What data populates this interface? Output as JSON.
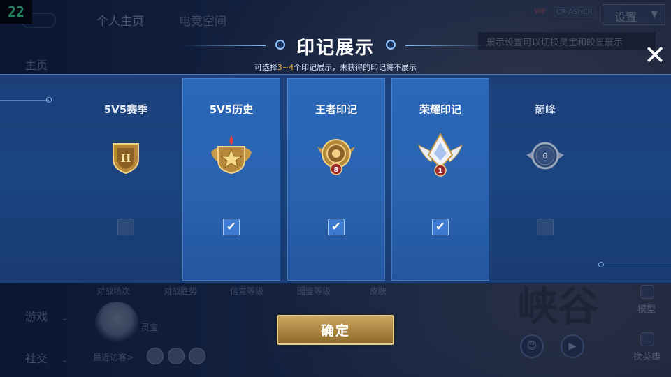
{
  "status": {
    "fps": "22"
  },
  "background": {
    "top_tabs": [
      "个人主页",
      "电竞空间"
    ],
    "vip_badge": "VIP",
    "vip_text": "CR·ASHCR",
    "settings_label": "设置",
    "settings_tip": "展示设置可以切换灵宝和皎显展示",
    "sidebar": {
      "home": "主页",
      "game": "游戏",
      "social": "社交"
    },
    "stats": [
      "对战场次",
      "对战胜势",
      "信誉等级",
      "图鉴等级",
      "皮肤"
    ],
    "pet_name": "灵宝",
    "recent_visitors": "最近访客>",
    "calligraphy": "峡谷",
    "model_label": "模型",
    "swap_label": "换英雄"
  },
  "modal": {
    "title": "印记展示",
    "subtitle_prefix": "可选择",
    "subtitle_highlight": "3~4",
    "subtitle_suffix": "个印记展示，未获得的印记将不展示",
    "cards": [
      {
        "title": "5V5赛季",
        "emblem": "season-shield-icon",
        "badge": "II",
        "checked": false
      },
      {
        "title": "5V5历史",
        "emblem": "history-star-badge-icon",
        "badge": "",
        "checked": true
      },
      {
        "title": "王者印记",
        "emblem": "king-mark-icon",
        "badge": "8",
        "checked": true
      },
      {
        "title": "荣耀印记",
        "emblem": "glory-mark-icon",
        "badge": "1",
        "checked": true
      },
      {
        "title": "巅峰",
        "emblem": "peak-mark-icon",
        "badge": "0",
        "checked": false
      }
    ],
    "checkmark": "✔",
    "confirm_label": "确定",
    "close_glyph": "✕"
  },
  "colors": {
    "accent_gold": "#f0b32b",
    "button_gold": "#b8944f",
    "card_active": "#2b68b8",
    "panel": "#1c3f7a"
  }
}
